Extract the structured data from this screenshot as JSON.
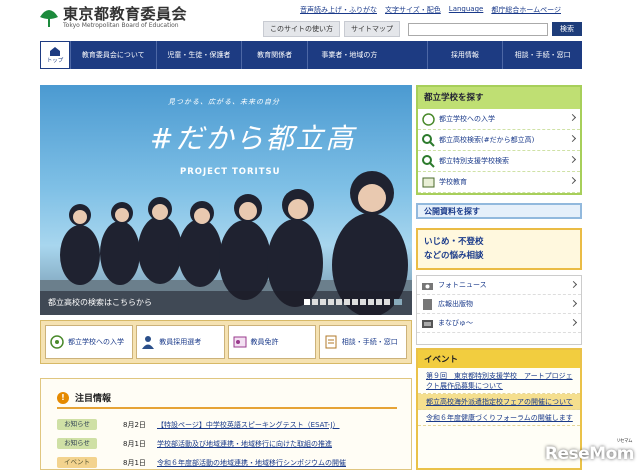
{
  "header": {
    "title": "東京都教育委員会",
    "subtitle": "Tokyo Metropolitan Board of Education",
    "util_links": [
      "音声読み上げ・ふりがな",
      "文字サイズ・配色",
      "Language",
      "都庁総合ホームページ"
    ],
    "how_to_use": "このサイトの使い方",
    "sitemap": "サイトマップ",
    "search_placeholder": "",
    "search_button": "検索"
  },
  "nav": {
    "home": "トップ",
    "items": [
      "教育委員会について",
      "児童・生徒・保護者",
      "教育関係者",
      "事業者・地域の方",
      "採用情報",
      "相談・手続・窓口"
    ]
  },
  "hero": {
    "tagline": "見つかる、広がる、未来の自分",
    "hashtag": "#だから都立高",
    "project": "PROJECT TORITSU",
    "caption": "都立高校の検索はこちらから"
  },
  "quick_links": [
    "都立学校への入学",
    "教員採用選考",
    "教員免許",
    "相談・手続・窓口"
  ],
  "notice": {
    "title": "注目情報",
    "rows": [
      {
        "tag": "お知らせ",
        "date": "8月2日",
        "text": "【特設ページ】中学校英語スピーキングテスト（ESAT-J）"
      },
      {
        "tag": "お知らせ",
        "date": "8月1日",
        "text": "学校部活動及び地域連携・地域移行に向けた取組の推進"
      },
      {
        "tag": "イベント",
        "date": "8月1日",
        "text": "令和６年度部活動の地域連携・地域移行シンポジウムの開催"
      }
    ]
  },
  "sidebar": {
    "school_search_title": "都立学校を探す",
    "school_items": [
      "都立学校への入学",
      "都立高校検索(#だから都立高)",
      "都立特別支援学校検索",
      "学校教育"
    ],
    "public_docs": "公開資料を探す",
    "bullying_line1": "いじめ・不登校",
    "bullying_line2": "などの悩み相談",
    "link_items": [
      "フォトニュース",
      "広報出版物",
      "まなびゅ～"
    ],
    "event_title": "イベント",
    "events": [
      "第９回　東京都特別支援学校　アートプロジェクト展作品募集について",
      "都立高校海外派遣指定校フェアの開催について",
      "令和６年度健康づくりフォーラムの開催します"
    ]
  },
  "watermark": {
    "text": "ReseMom",
    "sub": "リセマム"
  },
  "colors": {
    "nav": "#1d3b82",
    "green": "#a7cf5a",
    "yellow": "#eac249",
    "link": "#1a3a8a"
  }
}
